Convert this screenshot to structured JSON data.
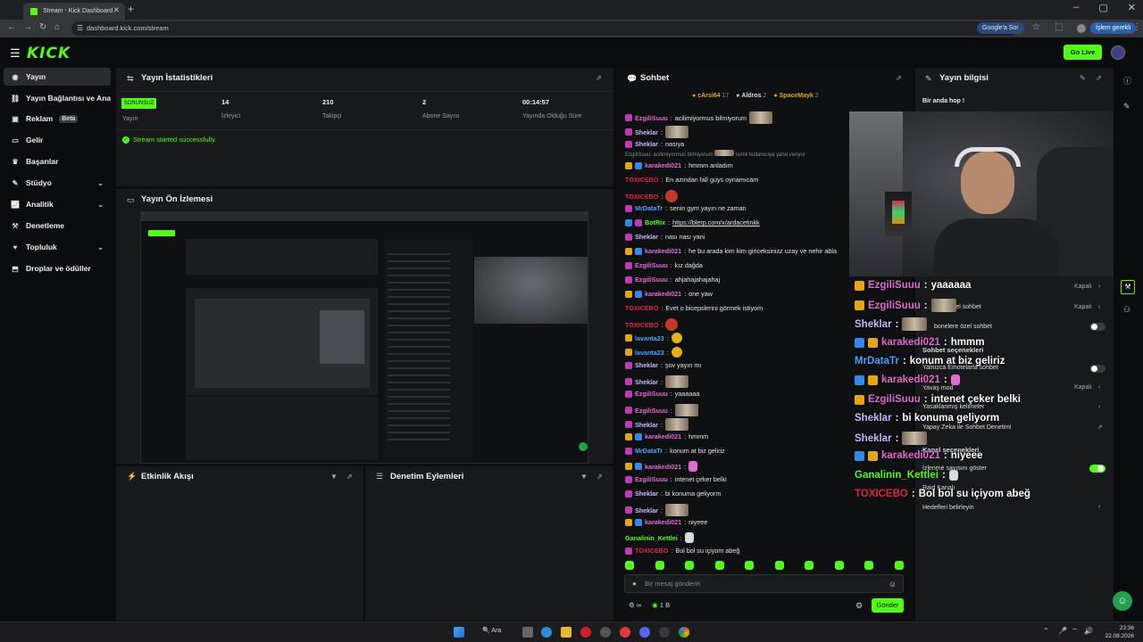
{
  "browser": {
    "tab_title": "Stream - Kick Dashboard",
    "url": "dashboard.kick.com/stream",
    "google_sor": "Google'a Sor",
    "islem_gerekli": "İşlem gerekli"
  },
  "header": {
    "logo": "KICK",
    "go_live": "Go Live"
  },
  "sidebar": {
    "items": [
      {
        "label": "Yayın",
        "icon": "broadcast-icon"
      },
      {
        "label": "Yayın Bağlantısı ve Anahtarı",
        "icon": "link-icon"
      },
      {
        "label": "Reklam",
        "icon": "ad-icon",
        "badge": "Beta"
      },
      {
        "label": "Gelir",
        "icon": "revenue-icon"
      },
      {
        "label": "Başarılar",
        "icon": "trophy-icon"
      },
      {
        "label": "Stüdyo",
        "icon": "studio-icon"
      },
      {
        "label": "Analitik",
        "icon": "analytics-icon"
      },
      {
        "label": "Denetleme",
        "icon": "moderation-icon"
      },
      {
        "label": "Topluluk",
        "icon": "community-icon"
      },
      {
        "label": "Droplar ve ödüller",
        "icon": "drops-icon"
      }
    ]
  },
  "stats": {
    "title": "Yayın İstatistikleri",
    "status_badge": "SORUNSUZ",
    "items": [
      {
        "value": "",
        "label": "Yayın"
      },
      {
        "value": "14",
        "label": "İzleyici"
      },
      {
        "value": "210",
        "label": "Takipçi"
      },
      {
        "value": "2",
        "label": "Abone Sayısı"
      },
      {
        "value": "00:14:57",
        "label": "Yayında Olduğu Süre"
      }
    ],
    "message": "Stream started successfully."
  },
  "preview": {
    "title": "Yayın Ön İzlemesi"
  },
  "activity": {
    "title": "Etkinlik Akışı"
  },
  "mod_actions": {
    "title": "Denetim Eylemleri"
  },
  "chat": {
    "title": "Sohbet",
    "top_gifters": [
      {
        "name": "cArsi64",
        "count": "17"
      },
      {
        "name": "Aldros",
        "count": "2"
      },
      {
        "name": "SpaceMayk",
        "count": "2"
      }
    ],
    "reply_context": "EzgiliSuuu: acilimiyormus bilmiyorum",
    "reply_hint": "isimli kullanıcıya yanıt veriyor",
    "messages": [
      {
        "user": "EzgiliSuuu",
        "color": "#e06cd0",
        "badges": [
          "sub"
        ],
        "text": "acilimiyormus bilmiyorum",
        "emote": "face"
      },
      {
        "user": "Sheklar",
        "color": "#c9b6ff",
        "badges": [
          "sub"
        ],
        "text": "",
        "emote": "face"
      },
      {
        "user": "Sheklar",
        "color": "#c9b6ff",
        "badges": [
          "sub"
        ],
        "text": "nasıya",
        "emote": ""
      },
      {
        "user": "karakedi021",
        "color": "#e06cd0",
        "badges": [
          "vip",
          "og"
        ],
        "text": "hmmm anladım",
        "emote": ""
      },
      {
        "user": "TOXICEBO",
        "color": "#e0264a",
        "badges": [],
        "text": "En azından fall guys oynamıcam",
        "emote": ""
      },
      {
        "user": "TOXICEBO",
        "color": "#e0264a",
        "badges": [],
        "text": "",
        "emote": "red"
      },
      {
        "user": "MrDataTr",
        "color": "#4aa3ff",
        "badges": [
          "sub"
        ],
        "text": "senin gym yayın ne zaman",
        "emote": ""
      },
      {
        "user": "BotRix",
        "color": "#53fc18",
        "badges": [
          "og",
          "sub"
        ],
        "text": "https://blerp.com/x/ardacetinkk",
        "emote": ""
      },
      {
        "user": "Sheklar",
        "color": "#c9b6ff",
        "badges": [
          "sub"
        ],
        "text": "nası nası yani",
        "emote": ""
      },
      {
        "user": "karakedi021",
        "color": "#e06cd0",
        "badges": [
          "vip",
          "og"
        ],
        "text": "he bu arada kim kim giriceksinizz uzay ve nehir abla",
        "emote": ""
      },
      {
        "user": "EzgiliSuuu",
        "color": "#e06cd0",
        "badges": [
          "sub"
        ],
        "text": "kız dağda",
        "emote": ""
      },
      {
        "user": "EzgiliSuuu",
        "color": "#e06cd0",
        "badges": [
          "sub"
        ],
        "text": "ahjahajahajahaj",
        "emote": ""
      },
      {
        "user": "karakedi021",
        "color": "#e06cd0",
        "badges": [
          "vip",
          "og"
        ],
        "text": "one yaw",
        "emote": ""
      },
      {
        "user": "TOXICEBO",
        "color": "#e0264a",
        "badges": [],
        "text": "Evet o bicepslerini görmek istiyom",
        "emote": ""
      },
      {
        "user": "TOXICEBO",
        "color": "#e0264a",
        "badges": [],
        "text": "",
        "emote": "red"
      },
      {
        "user": "lavanta23",
        "color": "#4aa3ff",
        "badges": [
          "vip"
        ],
        "text": "",
        "emote": "cat"
      },
      {
        "user": "lavanta23",
        "color": "#4aa3ff",
        "badges": [
          "vip"
        ],
        "text": "",
        "emote": "cat"
      },
      {
        "user": "Sheklar",
        "color": "#c9b6ff",
        "badges": [
          "sub"
        ],
        "text": "şov yayın mı",
        "emote": ""
      },
      {
        "user": "Sheklar",
        "color": "#c9b6ff",
        "badges": [
          "sub"
        ],
        "text": "",
        "emote": "face"
      },
      {
        "user": "EzgiliSuuu",
        "color": "#e06cd0",
        "badges": [
          "sub"
        ],
        "text": "yaaaaaa",
        "emote": ""
      },
      {
        "user": "EzgiliSuuu",
        "color": "#e06cd0",
        "badges": [
          "sub"
        ],
        "text": "",
        "emote": "face"
      },
      {
        "user": "Sheklar",
        "color": "#c9b6ff",
        "badges": [
          "sub"
        ],
        "text": "",
        "emote": "face"
      },
      {
        "user": "karakedi021",
        "color": "#e06cd0",
        "badges": [
          "vip",
          "og"
        ],
        "text": "hmmm",
        "emote": ""
      },
      {
        "user": "MrDataTr",
        "color": "#4aa3ff",
        "badges": [
          "sub"
        ],
        "text": "konum at biz geliriz",
        "emote": ""
      },
      {
        "user": "karakedi021",
        "color": "#e06cd0",
        "badges": [
          "vip",
          "og"
        ],
        "text": "",
        "emote": "pink"
      },
      {
        "user": "EzgiliSuuu",
        "color": "#e06cd0",
        "badges": [
          "sub"
        ],
        "text": "intenet çeker belki",
        "emote": ""
      },
      {
        "user": "Sheklar",
        "color": "#c9b6ff",
        "badges": [
          "sub"
        ],
        "text": "bi konuma geliyorm",
        "emote": ""
      },
      {
        "user": "Sheklar",
        "color": "#c9b6ff",
        "badges": [
          "sub"
        ],
        "text": "",
        "emote": "face"
      },
      {
        "user": "karakedi021",
        "color": "#e06cd0",
        "badges": [
          "vip",
          "og"
        ],
        "text": "niyeee",
        "emote": ""
      },
      {
        "user": "Ganalinin_Kettlei",
        "color": "#53fc18",
        "badges": [],
        "text": "",
        "emote": "hand"
      },
      {
        "user": "TOXICEBO",
        "color": "#e0264a",
        "badges": [
          "sub"
        ],
        "text": "Bol bol su içiyom abeğ",
        "emote": ""
      }
    ],
    "input_placeholder": "Bir mesaj gönderin",
    "footer_count": "1 B",
    "footer_points": "∞",
    "send": "Gönder"
  },
  "stream_info": {
    "title": "Yayın bilgisi",
    "stream_title": "Bir anda hop !",
    "overlay_messages": [
      {
        "user": "EzgiliSuuu",
        "color": "#e06cd0",
        "badges": [
          "vip"
        ],
        "text": "yaaaaaa",
        "emote": ""
      },
      {
        "user": "EzgiliSuuu",
        "color": "#e06cd0",
        "badges": [
          "vip"
        ],
        "text": "",
        "emote": "face"
      },
      {
        "user": "Sheklar",
        "color": "#c9b6ff",
        "badges": [],
        "text": "",
        "emote": "face"
      },
      {
        "user": "karakedi021",
        "color": "#e06cd0",
        "badges": [
          "og",
          "vip"
        ],
        "text": "hmmm",
        "emote": ""
      },
      {
        "user": "MrDataTr",
        "color": "#4aa3ff",
        "badges": [],
        "text": "konum at biz geliriz",
        "emote": ""
      },
      {
        "user": "karakedi021",
        "color": "#e06cd0",
        "badges": [
          "og",
          "vip"
        ],
        "text": "",
        "emote": "pink"
      },
      {
        "user": "EzgiliSuuu",
        "color": "#e06cd0",
        "badges": [
          "vip"
        ],
        "text": "intenet çeker belki",
        "emote": ""
      },
      {
        "user": "Sheklar",
        "color": "#c9b6ff",
        "badges": [],
        "text": "bi konuma geliyorm",
        "emote": ""
      },
      {
        "user": "Sheklar",
        "color": "#c9b6ff",
        "badges": [],
        "text": "",
        "emote": "face"
      },
      {
        "user": "karakedi021",
        "color": "#e06cd0",
        "badges": [
          "og",
          "vip"
        ],
        "text": "niyeee",
        "emote": ""
      },
      {
        "user": "Ganalinin_Kettlei",
        "color": "#53fc18",
        "badges": [],
        "text": "",
        "emote": "hand"
      },
      {
        "user": "TOXICEBO",
        "color": "#e0264a",
        "badges": [],
        "text": "Bol bol su içiyom abeğ",
        "emote": ""
      }
    ],
    "settings": {
      "ozel_sohbet": "özel sohbet",
      "kapali": "Kapalı",
      "bonelere": "bonelere özel sohbet",
      "sohbet_secenekleri": "Sohbet seçenekleri",
      "yalnizca_emote": "Yalnızca Emotelarla sohbet",
      "yavas_mod": "Yavaş mod",
      "yasaklanmis": "Yasaklanmış kelimeler",
      "yapay_zeka": "Yapay Zeka ile Sohbet Denetimi",
      "kanal_secenekleri": "Kanal seçenekleri",
      "izlenme_sayisi": "İzlenme sayısını göster",
      "raid": "Raid Kanalı",
      "hedefler": "Hedefleri belirleyin"
    }
  },
  "taskbar": {
    "search": "Ara",
    "time": "23:36",
    "date": "22.08.2026"
  },
  "colors": {
    "accent": "#53fc18",
    "panel": "#18191b",
    "bg": "#0b0c0d"
  }
}
